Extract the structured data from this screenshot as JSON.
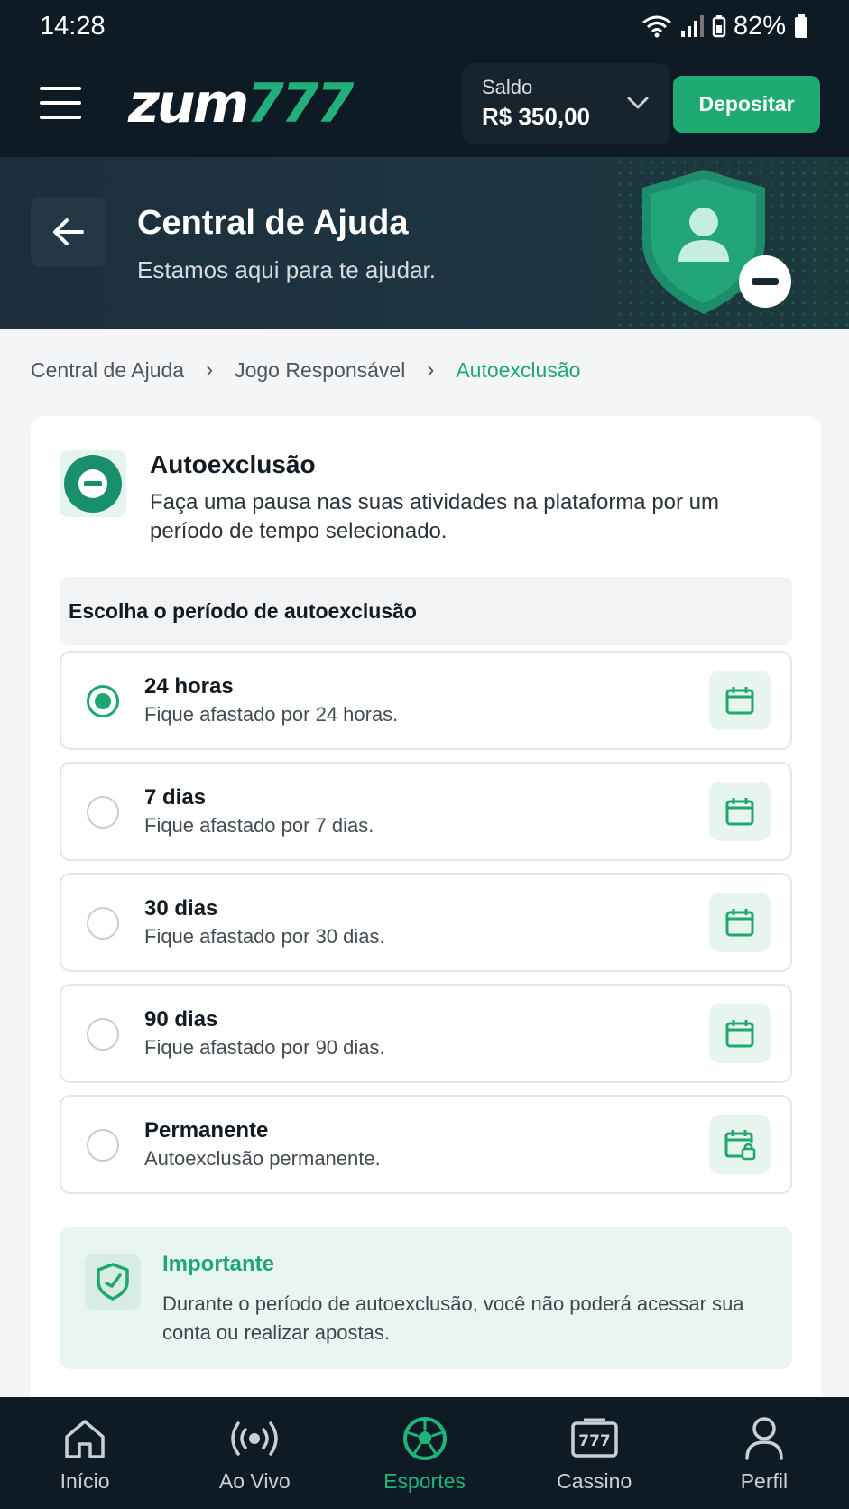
{
  "status_bar": {
    "time": "14:28",
    "battery": "82%"
  },
  "header": {
    "logo_part1": "zum",
    "logo_part2": "777",
    "balance_label": "Saldo",
    "balance_value": "R$ 350,00",
    "deposit_label": "Depositar"
  },
  "hero": {
    "title": "Central de Ajuda",
    "subtitle": "Estamos aqui para te ajudar."
  },
  "breadcrumb": {
    "items": [
      "Central de Ajuda",
      "Jogo Responsável",
      "Autoexclusão"
    ]
  },
  "card": {
    "title": "Autoexclusão",
    "description": "Faça uma pausa nas suas atividades na plataforma por um período de tempo selecionado.",
    "period_header": "Escolha o período de autoexclusão",
    "options": [
      {
        "title": "24 horas",
        "subtitle": "Fique afastado por 24 horas.",
        "selected": true,
        "icon": "calendar-icon"
      },
      {
        "title": "7 dias",
        "subtitle": "Fique afastado por 7 dias.",
        "selected": false,
        "icon": "calendar-icon"
      },
      {
        "title": "30 dias",
        "subtitle": "Fique afastado por 30 dias.",
        "selected": false,
        "icon": "calendar-icon"
      },
      {
        "title": "90 dias",
        "subtitle": "Fique afastado por 90 dias.",
        "selected": false,
        "icon": "calendar-icon"
      },
      {
        "title": "Permanente",
        "subtitle": "Autoexclusão permanente.",
        "selected": false,
        "icon": "calendar-lock-icon"
      }
    ],
    "notice": {
      "title": "Importante",
      "text": "Durante o período de autoexclusão, você não poderá acessar sua conta ou realizar apostas."
    }
  },
  "bottom_nav": {
    "items": [
      {
        "label": "Início",
        "icon": "home-icon",
        "active": false
      },
      {
        "label": "Ao Vivo",
        "icon": "live-icon",
        "active": false
      },
      {
        "label": "Esportes",
        "icon": "soccer-ball-icon",
        "active": true
      },
      {
        "label": "Cassino",
        "icon": "slot-machine-icon",
        "active": false
      },
      {
        "label": "Perfil",
        "icon": "user-icon",
        "active": false
      }
    ]
  },
  "colors": {
    "accent": "#1ea673",
    "dark": "#0f1b24"
  }
}
